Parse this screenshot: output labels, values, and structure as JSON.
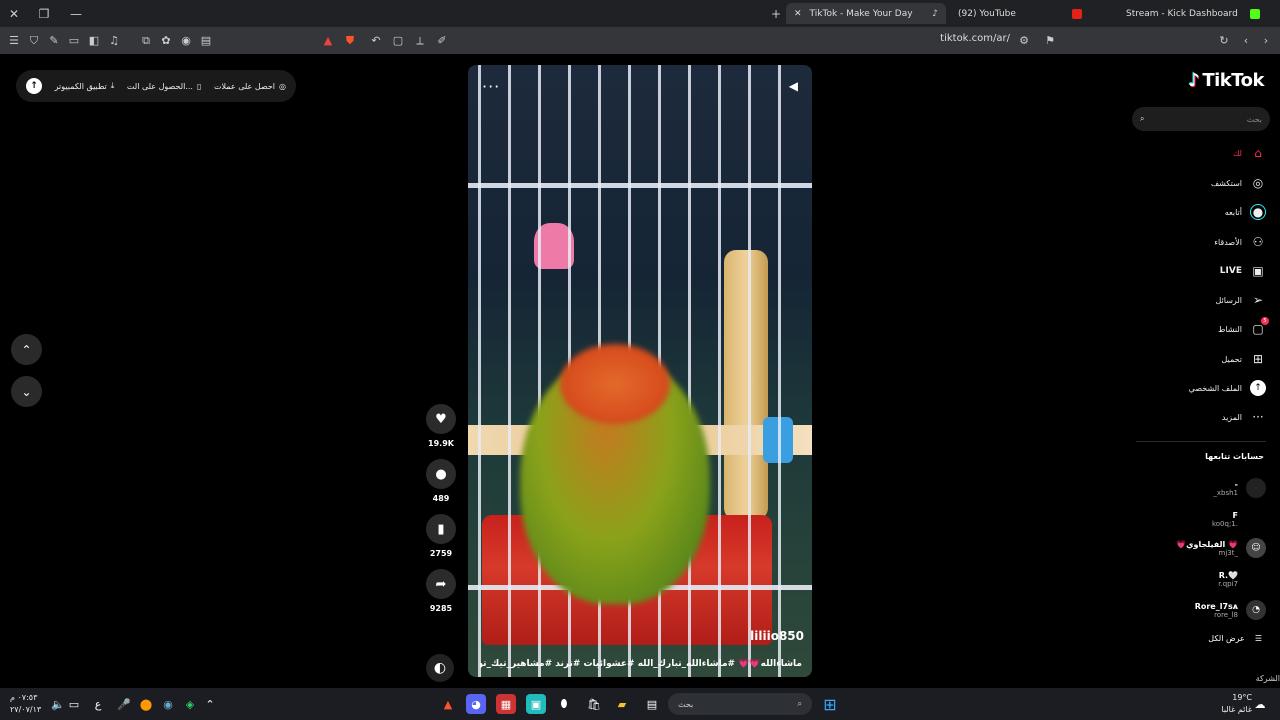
{
  "browser": {
    "tabs": [
      {
        "title": "TikTok - Make Your Day",
        "active": true
      },
      {
        "title": "(92) YouTube",
        "active": false
      },
      {
        "title": "Stream - Kick Dashboard",
        "active": false
      }
    ],
    "url": "tiktok.com/ar/"
  },
  "topbar": {
    "coins": "احصل على عملات",
    "app": "الحصول على الت...",
    "desktop": "تطبيق الكمبيوتر"
  },
  "video": {
    "author": "liliio850",
    "caption": "ماشاءالله💗💗 #ماشاءالله_تبارك_الله #عشوائيات #ترند #مشاهير_تيك_توك #روز"
  },
  "actions": {
    "likes": "19.9K",
    "comments": "489",
    "saves": "2759",
    "shares": "9285"
  },
  "sidebar": {
    "logo": "TikTok",
    "search_placeholder": "بحث",
    "menu": [
      {
        "label": "لك",
        "icon": "home-icon"
      },
      {
        "label": "استكشف",
        "icon": "compass-icon"
      },
      {
        "label": "أتابعه",
        "icon": "avatar-icon"
      },
      {
        "label": "الأصدقاء",
        "icon": "friends-icon"
      },
      {
        "label": "LIVE",
        "icon": "live-icon"
      },
      {
        "label": "الرسائل",
        "icon": "send-icon"
      },
      {
        "label": "النشاط",
        "icon": "inbox-icon"
      },
      {
        "label": "تحميل",
        "icon": "upload-icon"
      },
      {
        "label": "الملف الشخصي",
        "icon": "profile-icon"
      },
      {
        "label": "المزيد",
        "icon": "more-icon"
      }
    ],
    "activity_badge": "5",
    "following_title": "حسابات تتابعها",
    "accounts": [
      {
        "name": "-",
        "handle": "_xbsh1"
      },
      {
        "name": "F",
        "handle": "ko0q;1."
      },
      {
        "name": "💗الفيلجاوي 💗",
        "handle": "mj3t_"
      },
      {
        "name": "R.🤍",
        "handle": "r.qpi7"
      },
      {
        "name": "Rore_l7sᴀ",
        "handle": "rore_l8"
      }
    ],
    "show_all": "عرض الكل",
    "company": "الشركة"
  },
  "taskbar": {
    "search": "بحث",
    "time": "٠٧:٥٣ م",
    "date": "٢٧/٠٧/١٣",
    "temp": "19°C",
    "weather": "غائم غالبا",
    "lang": "ع"
  },
  "colors": {
    "accent": "#fe2c55",
    "background": "#000000",
    "sidebar_text": "#eeeeee"
  }
}
